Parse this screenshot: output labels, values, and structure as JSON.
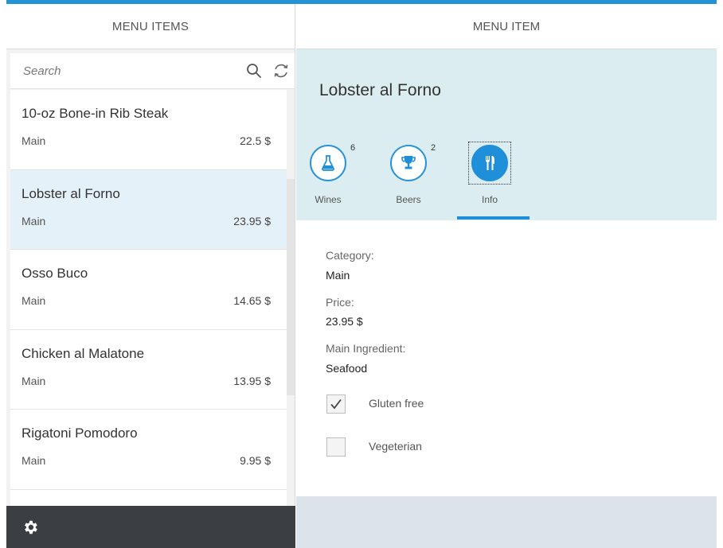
{
  "master": {
    "header_title": "MENU ITEMS",
    "search": {
      "placeholder": "Search",
      "value": ""
    },
    "items": [
      {
        "title": "10-oz Bone-in Rib Steak",
        "category": "Main",
        "price": "22.5 $"
      },
      {
        "title": "Lobster al Forno",
        "category": "Main",
        "price": "23.95 $"
      },
      {
        "title": "Osso Buco",
        "category": "Main",
        "price": "14.65 $"
      },
      {
        "title": "Chicken al Malatone",
        "category": "Main",
        "price": "13.95 $"
      },
      {
        "title": "Rigatoni Pomodoro",
        "category": "Main",
        "price": "9.95 $"
      }
    ],
    "selected_index": 1
  },
  "detail": {
    "header_title": "MENU ITEM",
    "title": "Lobster al Forno",
    "tabs": [
      {
        "label": "Wines",
        "count": "6",
        "icon": "flask-icon"
      },
      {
        "label": "Beers",
        "count": "2",
        "icon": "trophy-icon"
      },
      {
        "label": "Info",
        "count": "",
        "icon": "fork-knife-icon"
      }
    ],
    "active_tab": "Info",
    "fields": {
      "category_label": "Category:",
      "category_value": "Main",
      "price_label": "Price:",
      "price_value": "23.95 $",
      "ingredient_label": "Main Ingredient:",
      "ingredient_value": "Seafood"
    },
    "checkboxes": [
      {
        "label": "Gluten free",
        "checked": true
      },
      {
        "label": "Vegeterian",
        "checked": false
      }
    ]
  },
  "colors": {
    "accent": "#1e8fd8",
    "header_bg": "#dcedf1",
    "footer_dark": "#3b3f43",
    "selected_row": "#e5f1f8"
  }
}
